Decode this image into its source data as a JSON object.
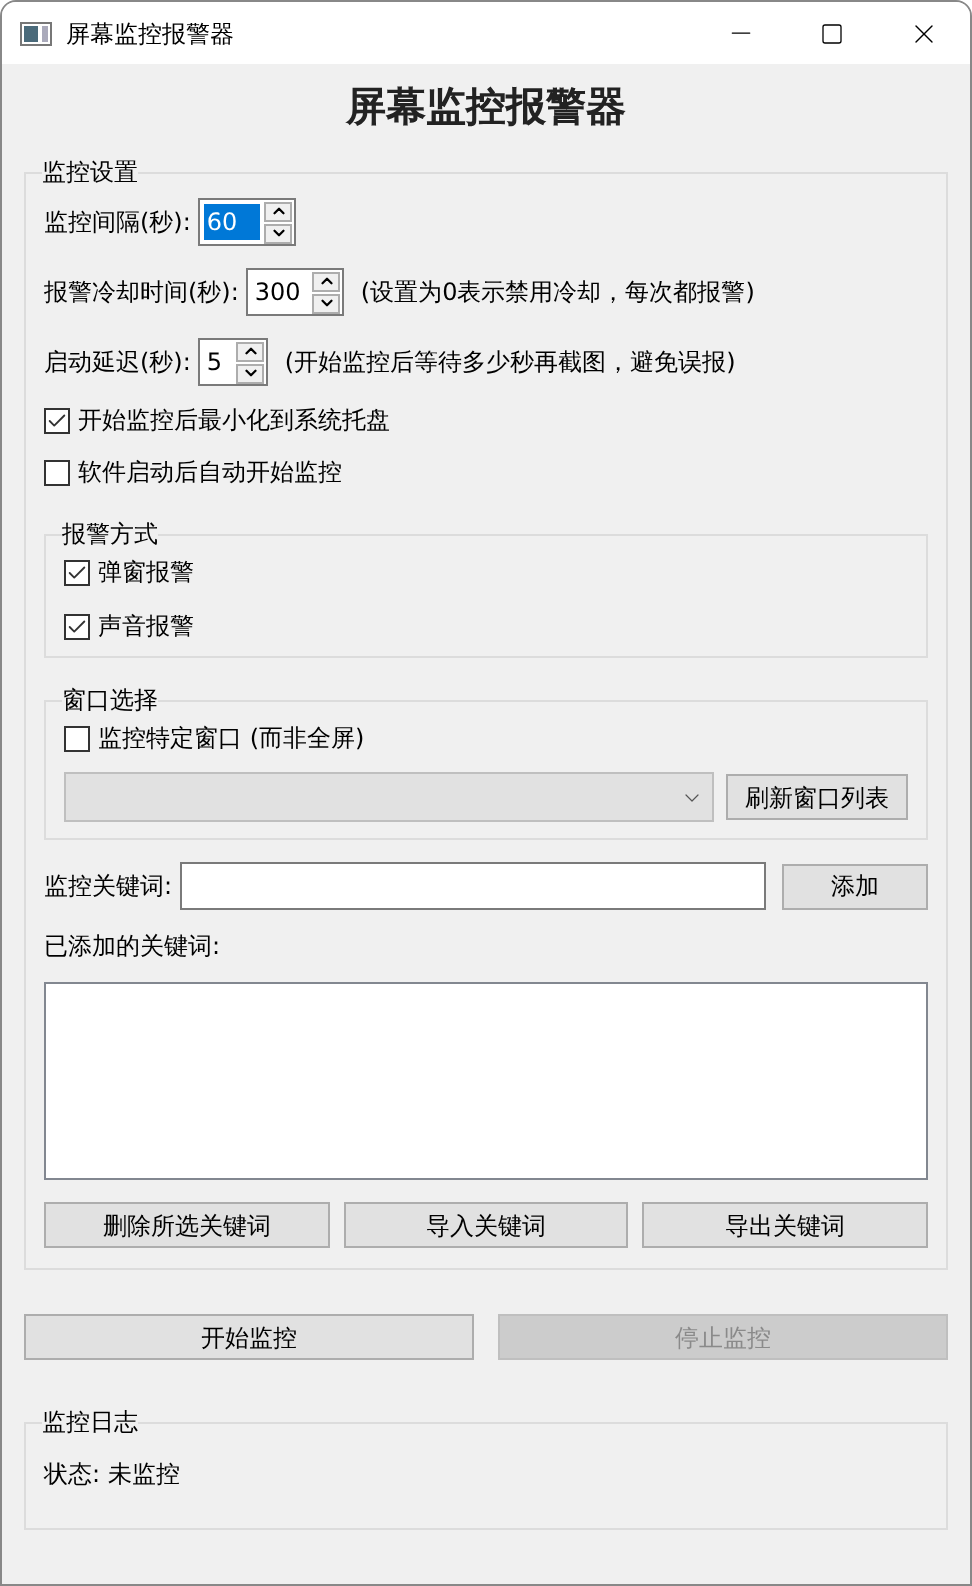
{
  "window": {
    "title": "屏幕监控报警器"
  },
  "heading": "屏幕监控报警器",
  "settings": {
    "title": "监控设置",
    "spinboxes": [
      {
        "label": "监控间隔(秒):",
        "value": "60",
        "highlighted": true
      },
      {
        "label": "报警冷却时间(秒):",
        "value": "300",
        "highlighted": false,
        "note": "(设置为0表示禁用冷却，每次都报警)"
      },
      {
        "label": "启动延迟(秒):",
        "value": "5",
        "highlighted": false,
        "note": "(开始监控后等待多少秒再截图，避免误报)"
      }
    ],
    "checkboxes": [
      {
        "label": "开始监控后最小化到系统托盘",
        "checked": true
      },
      {
        "label": "软件启动后自动开始监控",
        "checked": false
      }
    ],
    "alert_group": {
      "title": "报警方式",
      "checkboxes": [
        {
          "label": "弹窗报警",
          "checked": true
        },
        {
          "label": "声音报警",
          "checked": true
        }
      ]
    },
    "window_group": {
      "title": "窗口选择",
      "checkbox": {
        "label": "监控特定窗口 (而非全屏)",
        "checked": false
      },
      "combo": {
        "disabled": true
      },
      "refresh_button": "刷新窗口列表"
    },
    "keyword": {
      "label": "监控关键词:",
      "add_button": "添加"
    },
    "keyword_list": {
      "label": "已添加的关键词:"
    },
    "list_buttons": [
      "删除所选关键词",
      "导入关键词",
      "导出关键词"
    ]
  },
  "actions": [
    {
      "label": "开始监控",
      "disabled": false
    },
    {
      "label": "停止监控",
      "disabled": true
    }
  ],
  "log": {
    "title": "监控日志",
    "status": "状态: 未监控"
  }
}
